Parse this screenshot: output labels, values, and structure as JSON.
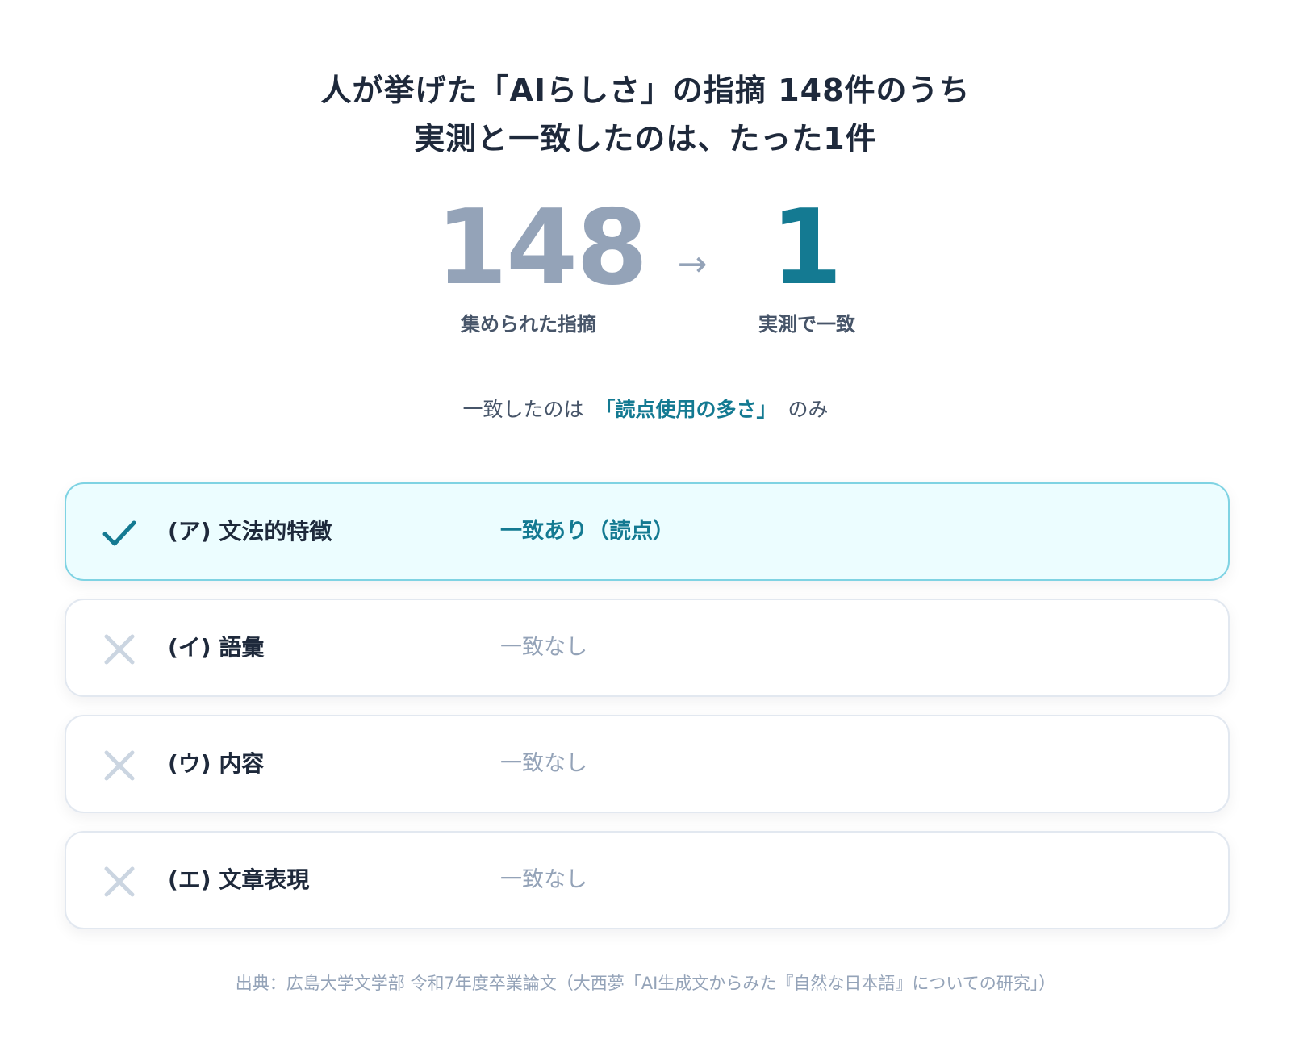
{
  "headline": {
    "line1": "人が挙げた「AIらしさ」の指摘 148件のうち",
    "line2": "実測と一致したのは、たった1件"
  },
  "stats": {
    "before_value": "148",
    "before_label": "集められた指摘",
    "arrow": "→",
    "after_value": "1",
    "after_label": "実測で一致"
  },
  "summary": {
    "prefix": "一致したのは",
    "highlight": "「読点使用の多さ」",
    "suffix": "のみ"
  },
  "items": [
    {
      "label": "(ア) 文法的特徴",
      "result": "一致あり（読点）",
      "matched": true,
      "icon": "check-icon"
    },
    {
      "label": "(イ) 語彙",
      "result": "一致なし",
      "matched": false,
      "icon": "x-icon"
    },
    {
      "label": "(ウ) 内容",
      "result": "一致なし",
      "matched": false,
      "icon": "x-icon"
    },
    {
      "label": "(エ) 文章表現",
      "result": "一致なし",
      "matched": false,
      "icon": "x-icon"
    }
  ],
  "source": "出典：広島大学文学部 令和7年度卒業論文（大西夢「AI生成文からみた『自然な日本語』についての研究」）",
  "colors": {
    "accent": "#147a92",
    "muted": "#94a3b8",
    "match_bg": "#ecfdff",
    "match_border": "#7fd3e3"
  }
}
